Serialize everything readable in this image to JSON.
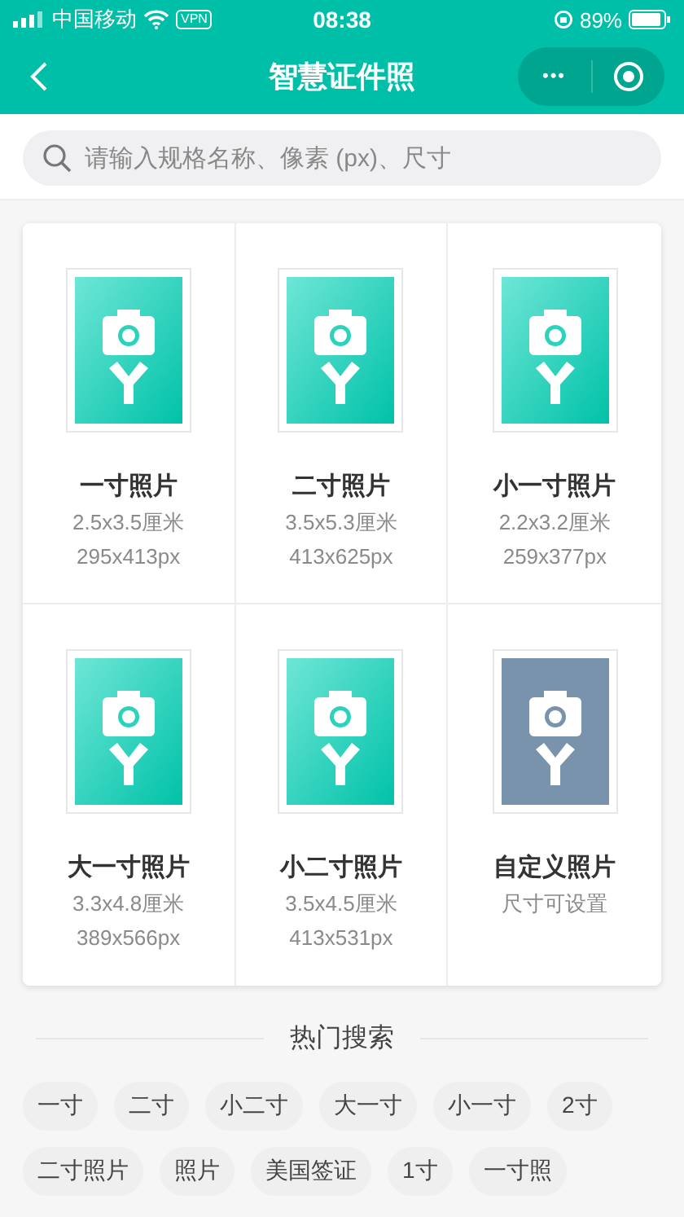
{
  "status_bar": {
    "carrier": "中国移动",
    "vpn": "VPN",
    "time": "08:38",
    "battery": "89%"
  },
  "nav": {
    "title": "智慧证件照",
    "more": "•••"
  },
  "search": {
    "placeholder": "请输入规格名称、像素 (px)、尺寸"
  },
  "sizes": [
    {
      "kind": "preset",
      "name": "一寸照片",
      "lines": [
        "2.5x3.5厘米",
        "295x413px"
      ]
    },
    {
      "kind": "preset",
      "name": "二寸照片",
      "lines": [
        "3.5x5.3厘米",
        "413x625px"
      ]
    },
    {
      "kind": "preset",
      "name": "小一寸照片",
      "lines": [
        "2.2x3.2厘米",
        "259x377px"
      ]
    },
    {
      "kind": "preset",
      "name": "大一寸照片",
      "lines": [
        "3.3x4.8厘米",
        "389x566px"
      ]
    },
    {
      "kind": "preset",
      "name": "小二寸照片",
      "lines": [
        "3.5x4.5厘米",
        "413x531px"
      ]
    },
    {
      "kind": "custom",
      "name": "自定义照片",
      "lines": [
        "尺寸可设置"
      ]
    }
  ],
  "hot_search": {
    "title": "热门搜索",
    "tags": [
      "一寸",
      "二寸",
      "小二寸",
      "大一寸",
      "小一寸",
      "2寸",
      "二寸照片",
      "照片",
      "美国签证",
      "1寸",
      "一寸照"
    ]
  }
}
